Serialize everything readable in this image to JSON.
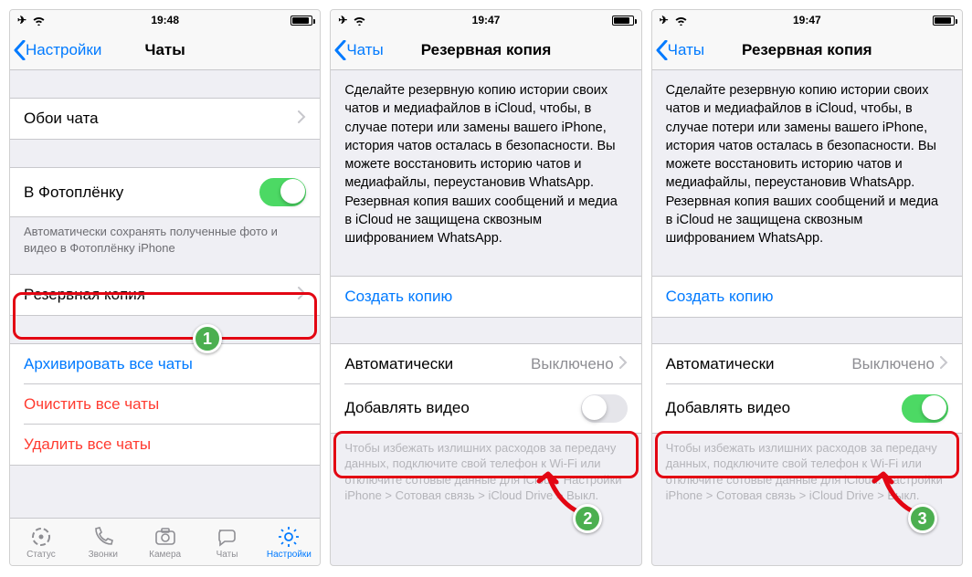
{
  "screen1": {
    "status": {
      "time": "19:48"
    },
    "nav": {
      "back": "Настройки",
      "title": "Чаты"
    },
    "rows": {
      "wallpaper": "Обои чата",
      "camera_roll": "В Фотоплёнку",
      "camera_roll_footer": "Автоматически сохранять полученные фото и видео в Фотоплёнку iPhone",
      "backup": "Резервная копия",
      "archive": "Архивировать все чаты",
      "clear": "Очистить все чаты",
      "delete": "Удалить все чаты"
    },
    "tabs": {
      "status": "Статус",
      "calls": "Звонки",
      "camera": "Камера",
      "chats": "Чаты",
      "settings": "Настройки"
    },
    "badge": "1"
  },
  "screen2": {
    "status": {
      "time": "19:47"
    },
    "nav": {
      "back": "Чаты",
      "title": "Резервная копия"
    },
    "intro": "Сделайте резервную копию истории своих чатов и медиафайлов в iCloud, чтобы, в случае потери или замены вашего iPhone, история чатов осталась в безопасности. Вы можете восстановить историю чатов и медиафайлы, переустановив WhatsApp. Резервная копия ваших сообщений и медиа в iCloud не защищена сквозным шифрованием WhatsApp.",
    "rows": {
      "create": "Создать копию",
      "auto": "Автоматически",
      "auto_value": "Выключено",
      "video": "Добавлять видео"
    },
    "footer": "Чтобы избежать излишних расходов за передачу данных, подключите свой телефон к Wi-Fi или отключите сотовые данные для iCloud: Настройки iPhone > Сотовая связь > iCloud Drive > Выкл.",
    "badge": "2"
  },
  "screen3": {
    "status": {
      "time": "19:47"
    },
    "nav": {
      "back": "Чаты",
      "title": "Резервная копия"
    },
    "badge": "3"
  }
}
